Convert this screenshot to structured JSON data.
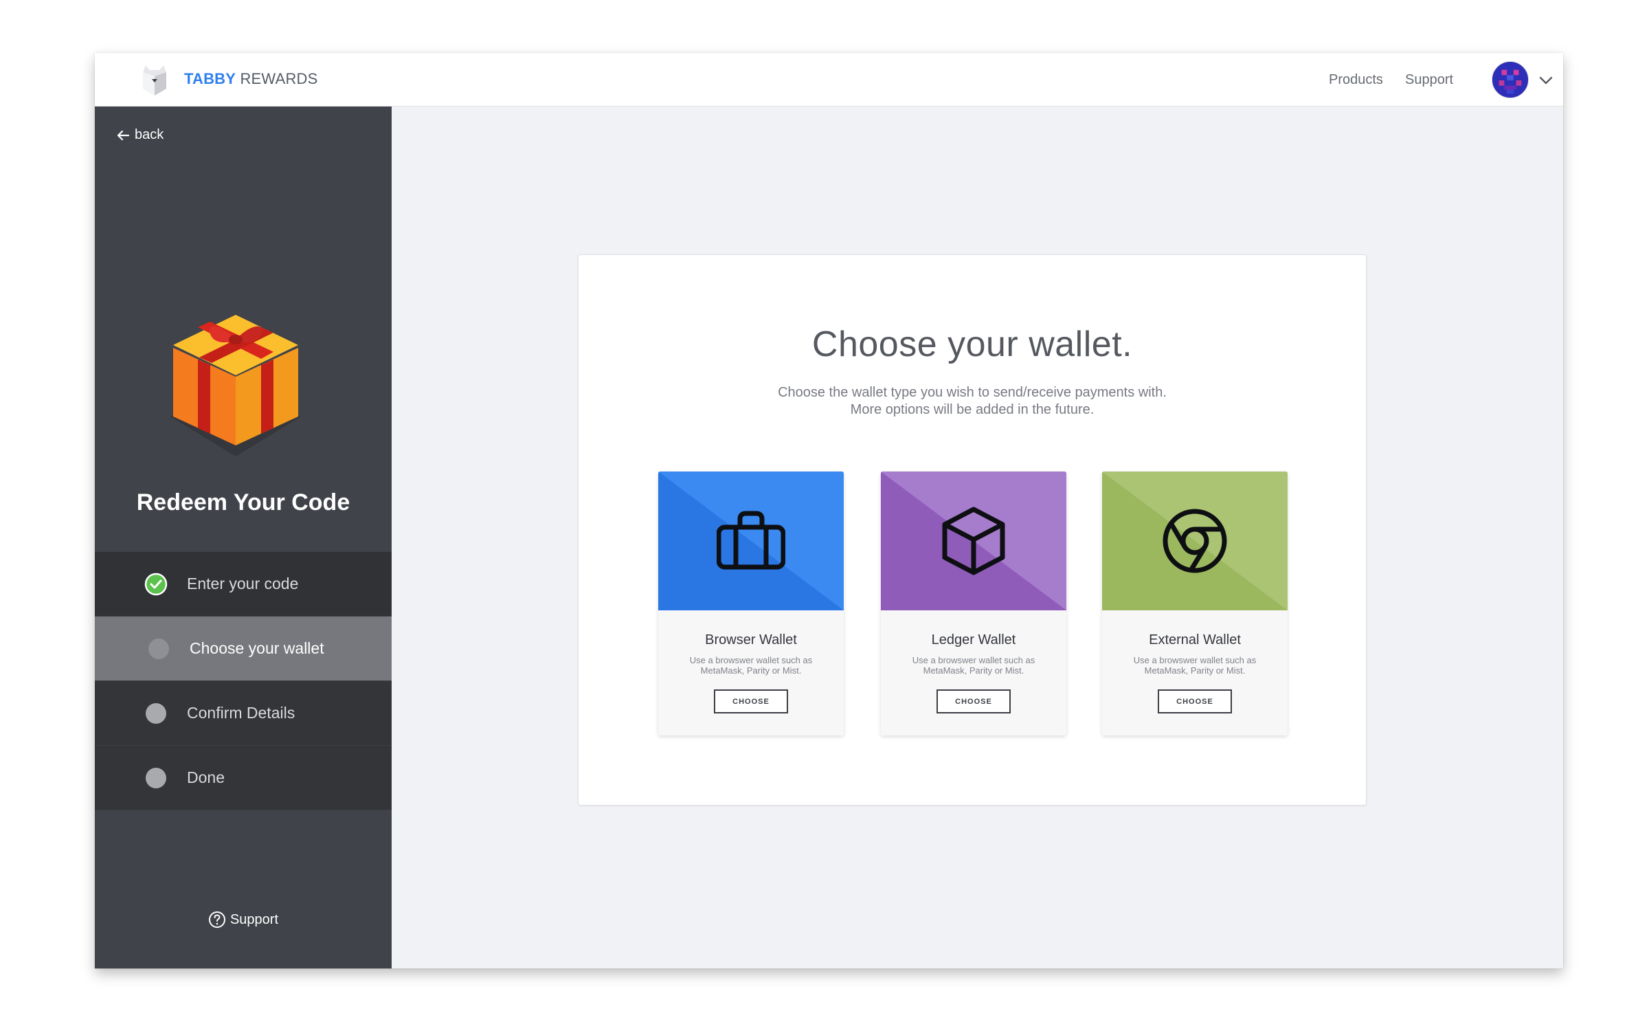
{
  "header": {
    "brand_primary": "TABBY",
    "brand_secondary": "REWARDS",
    "nav_products": "Products",
    "nav_support": "Support",
    "logo_icon": "cat-logo-icon",
    "avatar_icon": "user-avatar",
    "menu_icon": "chevron-down-icon"
  },
  "sidebar": {
    "back_label": "back",
    "title": "Redeem Your Code",
    "steps": [
      {
        "label": "Enter your code",
        "state": "completed"
      },
      {
        "label": "Choose your wallet",
        "state": "active"
      },
      {
        "label": "Confirm Details",
        "state": "pending"
      },
      {
        "label": "Done",
        "state": "pending"
      }
    ],
    "support_label": "Support"
  },
  "main": {
    "title": "Choose your wallet.",
    "subtitle_line1": "Choose the wallet type you wish to send/receive payments with.",
    "subtitle_line2": "More options will be added in the future.",
    "wallets": [
      {
        "name": "Browser Wallet",
        "desc_line1": "Use a browswer wallet such as",
        "desc_line2": "MetaMask, Parity or Mist.",
        "button": "CHOOSE",
        "color": "#2f80ed",
        "icon": "briefcase-icon"
      },
      {
        "name": "Ledger Wallet",
        "desc_line1": "Use a browswer wallet such as",
        "desc_line2": "MetaMask, Parity or Mist.",
        "button": "CHOOSE",
        "color": "#9b6cc4",
        "icon": "cube-icon"
      },
      {
        "name": "External Wallet",
        "desc_line1": "Use a browswer wallet such as",
        "desc_line2": "MetaMask, Parity or Mist.",
        "button": "CHOOSE",
        "color": "#a4bf6a",
        "icon": "chrome-icon"
      }
    ]
  },
  "colors": {
    "accent": "#2f80ed",
    "sidebar_bg": "#404349",
    "step_complete": "#5cc24d"
  }
}
